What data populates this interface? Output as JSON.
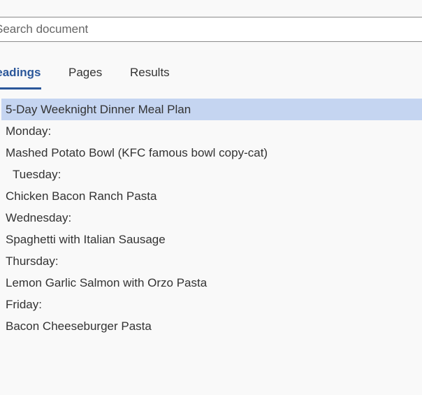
{
  "search": {
    "placeholder": "Search document"
  },
  "tabs": [
    {
      "label": "Headings",
      "active": true
    },
    {
      "label": "Pages",
      "active": false
    },
    {
      "label": "Results",
      "active": false
    }
  ],
  "headings": [
    {
      "text": "5-Day Weeknight Dinner Meal Plan",
      "selected": true
    },
    {
      "text": "Monday:"
    },
    {
      "text": "Mashed Potato Bowl (KFC famous bowl copy-cat)"
    },
    {
      "text": "Tuesday:"
    },
    {
      "text": "Chicken Bacon Ranch Pasta"
    },
    {
      "text": "Wednesday:"
    },
    {
      "text": "Spaghetti with Italian Sausage"
    },
    {
      "text": "Thursday:"
    },
    {
      "text": "Lemon Garlic Salmon with Orzo Pasta"
    },
    {
      "text": "Friday:"
    },
    {
      "text": "Bacon Cheeseburger Pasta"
    }
  ],
  "colors": {
    "accent": "#2b579a",
    "selection": "#c5d5f1",
    "background": "#f9f9f9"
  }
}
